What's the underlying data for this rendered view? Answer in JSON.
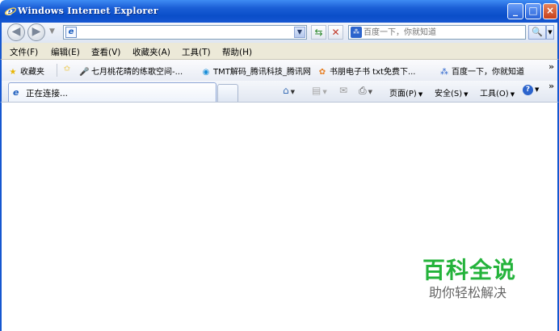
{
  "window": {
    "title": "Windows Internet Explorer",
    "minimize_glyph": "_",
    "maximize_glyph": "□",
    "close_glyph": "×"
  },
  "address": {
    "url": "",
    "back_icon": "back-arrow-icon",
    "forward_icon": "forward-arrow-icon"
  },
  "search": {
    "placeholder": "百度一下，你就知道"
  },
  "menu": [
    "文件(F)",
    "编辑(E)",
    "查看(V)",
    "收藏夹(A)",
    "工具(T)",
    "帮助(H)"
  ],
  "favorites": {
    "label": "收藏夹",
    "items": [
      "七月桃花晴的练歌空间-...",
      "TMT解码_腾讯科技_腾讯网",
      "书朋电子书 txt免费下...",
      "百度一下，你就知道"
    ],
    "more": "»"
  },
  "tabs": {
    "active_label": "正在连接..."
  },
  "commandbar": {
    "page": "页面(P)",
    "safety": "安全(S)",
    "tools": "工具(O)",
    "more": "»"
  },
  "watermark": {
    "title": "百科全说",
    "subtitle": "助你轻松解决"
  },
  "colors": {
    "titlebar": "#0a4ec9",
    "watermark_green": "#24b33b"
  }
}
